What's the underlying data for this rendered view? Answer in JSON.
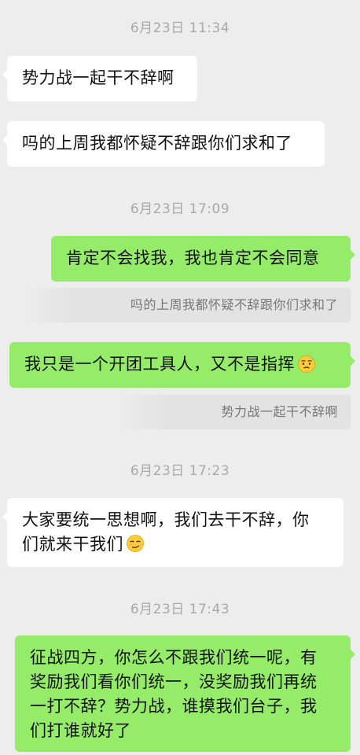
{
  "chat": {
    "messages": [
      {
        "type": "timestamp",
        "text": "6月23日 11:34"
      },
      {
        "type": "incoming",
        "text": "势力战一起干不辞啊"
      },
      {
        "type": "incoming",
        "text": "吗的上周我都怀疑不辞跟你们求和了"
      },
      {
        "type": "timestamp",
        "text": "6月23日 17:09"
      },
      {
        "type": "outgoing",
        "text": "肯定不会找我，我也肯定不会同意"
      },
      {
        "type": "quote",
        "text": "吗的上周我都怀疑不辞跟你们求和了"
      },
      {
        "type": "outgoing",
        "text": "我只是一个开团工具人，又不是指挥",
        "emoji": "weary-sweat-emoji"
      },
      {
        "type": "quote",
        "text": "势力战一起干不辞啊"
      },
      {
        "type": "timestamp",
        "text": "6月23日 17:23"
      },
      {
        "type": "incoming",
        "lines": [
          "大家要统一思想啊，我们去干不辞，你",
          "们就来干我们"
        ],
        "emoji": "smirk-emoji"
      },
      {
        "type": "timestamp",
        "text": "6月23日 17:43"
      },
      {
        "type": "outgoing",
        "lines": [
          "征战四方，你怎么不跟我们统一呢，有",
          "奖励我们看你们统一，没奖励我们再统",
          "一打不辞？势力战，谁摸我们台子，我",
          "们打谁就好了"
        ]
      }
    ]
  },
  "colors": {
    "background": "#ededed",
    "incoming_bubble": "#ffffff",
    "outgoing_bubble": "#95ec69",
    "timestamp_text": "#a9a9a9",
    "quote_background": "#e3e3e3",
    "quote_text": "#777777"
  }
}
